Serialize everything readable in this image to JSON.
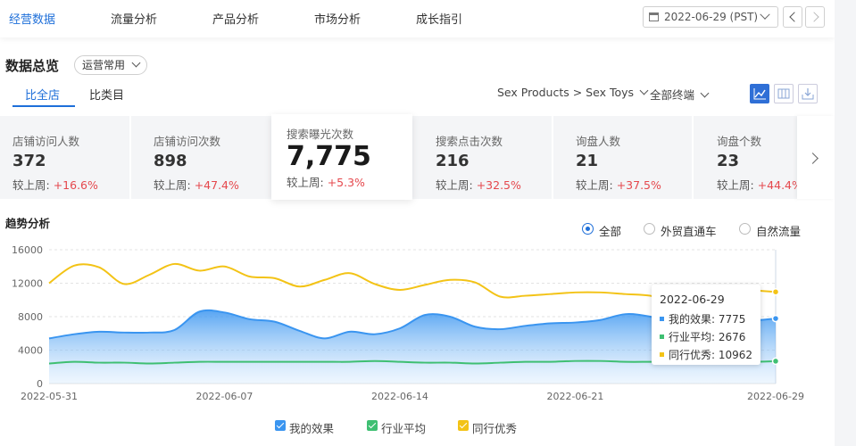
{
  "nav": {
    "items": [
      "经营数据",
      "流量分析",
      "产品分析",
      "市场分析",
      "成长指引"
    ],
    "active": 0,
    "date": "2022-06-29 (PST)"
  },
  "overview": {
    "title": "数据总览",
    "preset": "运营常用",
    "tabs": [
      "比全店",
      "比类目"
    ],
    "category": "Sex Products > Sex Toys",
    "terminal": "全部终端"
  },
  "metrics": [
    {
      "label": "店铺访问人数",
      "value": "372",
      "compare_label": "较上周:",
      "change": "+16.6%"
    },
    {
      "label": "店铺访问次数",
      "value": "898",
      "compare_label": "较上周:",
      "change": "+47.4%"
    },
    {
      "label": "搜索曝光次数",
      "value": "7,775",
      "compare_label": "较上周:",
      "change": "+5.3%"
    },
    {
      "label": "搜索点击次数",
      "value": "216",
      "compare_label": "较上周:",
      "change": "+32.5%"
    },
    {
      "label": "询盘人数",
      "value": "21",
      "compare_label": "较上周:",
      "change": "+37.5%"
    },
    {
      "label": "询盘个数",
      "value": "23",
      "compare_label": "较上周:",
      "change": "+44.4%"
    }
  ],
  "trend": {
    "title": "趋势分析",
    "filters": [
      "全部",
      "外贸直通车",
      "自然流量"
    ],
    "selected_filter": 0
  },
  "tooltip": {
    "date": "2022-06-29",
    "rows": [
      {
        "label": "我的效果: 7775",
        "color": "#3a95f0"
      },
      {
        "label": "行业平均: 2676",
        "color": "#3fbf72"
      },
      {
        "label": "同行优秀: 10962",
        "color": "#f3c316"
      }
    ]
  },
  "chart_data": {
    "type": "area",
    "x": [
      "2022-05-31",
      "2022-06-01",
      "2022-06-02",
      "2022-06-03",
      "2022-06-04",
      "2022-06-05",
      "2022-06-06",
      "2022-06-07",
      "2022-06-08",
      "2022-06-09",
      "2022-06-10",
      "2022-06-11",
      "2022-06-12",
      "2022-06-13",
      "2022-06-14",
      "2022-06-15",
      "2022-06-16",
      "2022-06-17",
      "2022-06-18",
      "2022-06-19",
      "2022-06-20",
      "2022-06-21",
      "2022-06-22",
      "2022-06-23",
      "2022-06-24",
      "2022-06-25",
      "2022-06-26",
      "2022-06-27",
      "2022-06-28",
      "2022-06-29"
    ],
    "xticks": [
      "2022-05-31",
      "2022-06-07",
      "2022-06-14",
      "2022-06-21",
      "2022-06-29"
    ],
    "ylim": [
      0,
      16000
    ],
    "yticks": [
      0,
      4000,
      8000,
      12000,
      16000
    ],
    "series": [
      {
        "name": "我的效果",
        "color": "#3a95f0",
        "values": [
          5400,
          5900,
          6200,
          6100,
          6100,
          6400,
          8600,
          8500,
          7700,
          7400,
          6300,
          5400,
          6200,
          5900,
          6600,
          8200,
          8000,
          6800,
          6500,
          6900,
          7200,
          7300,
          7600,
          8300,
          8000,
          7200,
          7200,
          7300,
          7500,
          7775
        ]
      },
      {
        "name": "行业平均",
        "color": "#3fbf72",
        "values": [
          2400,
          2600,
          2500,
          2500,
          2400,
          2500,
          2600,
          2600,
          2600,
          2600,
          2600,
          2600,
          2600,
          2700,
          2600,
          2500,
          2500,
          2400,
          2500,
          2600,
          2600,
          2700,
          2700,
          2600,
          2600,
          2600,
          2600,
          2600,
          2600,
          2676
        ]
      },
      {
        "name": "同行优秀",
        "color": "#f3c316",
        "values": [
          12000,
          14100,
          13900,
          11900,
          13000,
          14300,
          13500,
          14000,
          12800,
          12600,
          11600,
          12400,
          13200,
          11900,
          11200,
          11800,
          12400,
          12100,
          10400,
          10500,
          10700,
          10900,
          10900,
          10700,
          10500,
          9700,
          11100,
          11700,
          11200,
          10962
        ]
      }
    ]
  }
}
